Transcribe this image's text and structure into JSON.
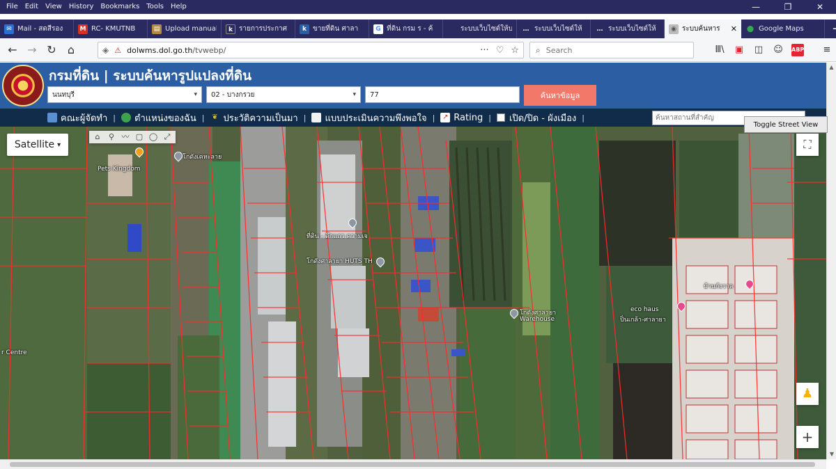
{
  "menubar": {
    "items": [
      "File",
      "Edit",
      "View",
      "History",
      "Bookmarks",
      "Tools",
      "Help"
    ],
    "min": "—",
    "max": "❐",
    "close": "✕"
  },
  "tabs": [
    {
      "title": "Mail - สดสีรอง",
      "fav": "✉",
      "color": "#2a6fd6"
    },
    {
      "title": "RC- KMUTNB",
      "fav": "M",
      "color": "#d93025"
    },
    {
      "title": "Upload manual",
      "fav": "▤",
      "color": "#b58a3c"
    },
    {
      "title": "รายการประกาศ",
      "fav": "k",
      "color": "#2b2a60"
    },
    {
      "title": "ขายที่ดิน ศาลา",
      "fav": "k",
      "color": "#2b5ea2"
    },
    {
      "title": "ที่ดิน กรม ร - ค้",
      "fav": "G",
      "color": "#4a8af4"
    },
    {
      "title": "ระบบเว็บไซต์ให้บ",
      "fav": "",
      "color": "#2b2a60"
    },
    {
      "title": "ระบบเว็บไซต์ให้",
      "fav": "…",
      "color": "#2b2a60"
    },
    {
      "title": "ระบบเว็บไซต์ให้",
      "fav": "…",
      "color": "#2b2a60"
    },
    {
      "title": "ระบบค้นหาร",
      "fav": "◉",
      "color": "#7a7a7a",
      "active": true,
      "close": "✕"
    },
    {
      "title": "Google Maps",
      "fav": "⬤",
      "color": "#34a853",
      "maps": true
    }
  ],
  "newtab": "+",
  "navbar": {
    "back": "←",
    "forward": "→",
    "reload": "↻",
    "home": "⌂",
    "shield": "◈",
    "lock": "⚠",
    "url_host": "dolwms.dol.go.th",
    "url_path": "/tvwebp/",
    "more": "···",
    "pocket": "♡",
    "bookmark": "☆",
    "search_placeholder": "Search",
    "search_icon": "⌕",
    "library": "Ⅲ\\",
    "sync": "▣",
    "reader": "◫",
    "account": "☺",
    "ext": "ABP",
    "menu": "≡"
  },
  "header": {
    "title": "กรมที่ดิน | ระบบค้นหารูปแปลงที่ดิน",
    "province": "นนทบุรี",
    "district": "02 - บางกรวย",
    "parcel_number": "77",
    "search_button": "ค้นหาข้อมูล",
    "caret": "▾"
  },
  "sitenav": {
    "committee": "คณะผู้จัดทำ",
    "offices": "ตำแหน่งของฉัน",
    "history": "ประวัติความเป็นมา",
    "survey": "แบบประเมินความพึงพอใจ",
    "rating": "Rating",
    "toggle_layer": "เปิด/ปิด - ผังเมือง",
    "place_search_placeholder": "ค้นหาสถานที่สำคัญ",
    "sep": "|"
  },
  "map": {
    "satellite": "Satellite",
    "satellite_caret": "▾",
    "toggle_street_view": "Toggle Street View",
    "fullscreen": "⛶",
    "pegman": "♟",
    "zoom_in": "+",
    "draw_tools": [
      "⌂",
      "⚲",
      "〰",
      "▢",
      "◯",
      "⤢"
    ],
    "labels": {
      "l1": "Pets Kingdom",
      "l2": "โกดังเคหะลาย",
      "l3": "ที่ดิน - ตึกแถว ความเจ",
      "l4": "โกดังศาลายา HUTS TH",
      "l5": "โกดังศาลายา",
      "l6": "Warehouse",
      "l7": "eco haus",
      "l8": "ปิ่นเกล้า-ศาลายา",
      "l9": "r Centre",
      "l10": "บ้านกังวาล"
    }
  },
  "scroll": {
    "up": "▲",
    "down": "▼"
  }
}
